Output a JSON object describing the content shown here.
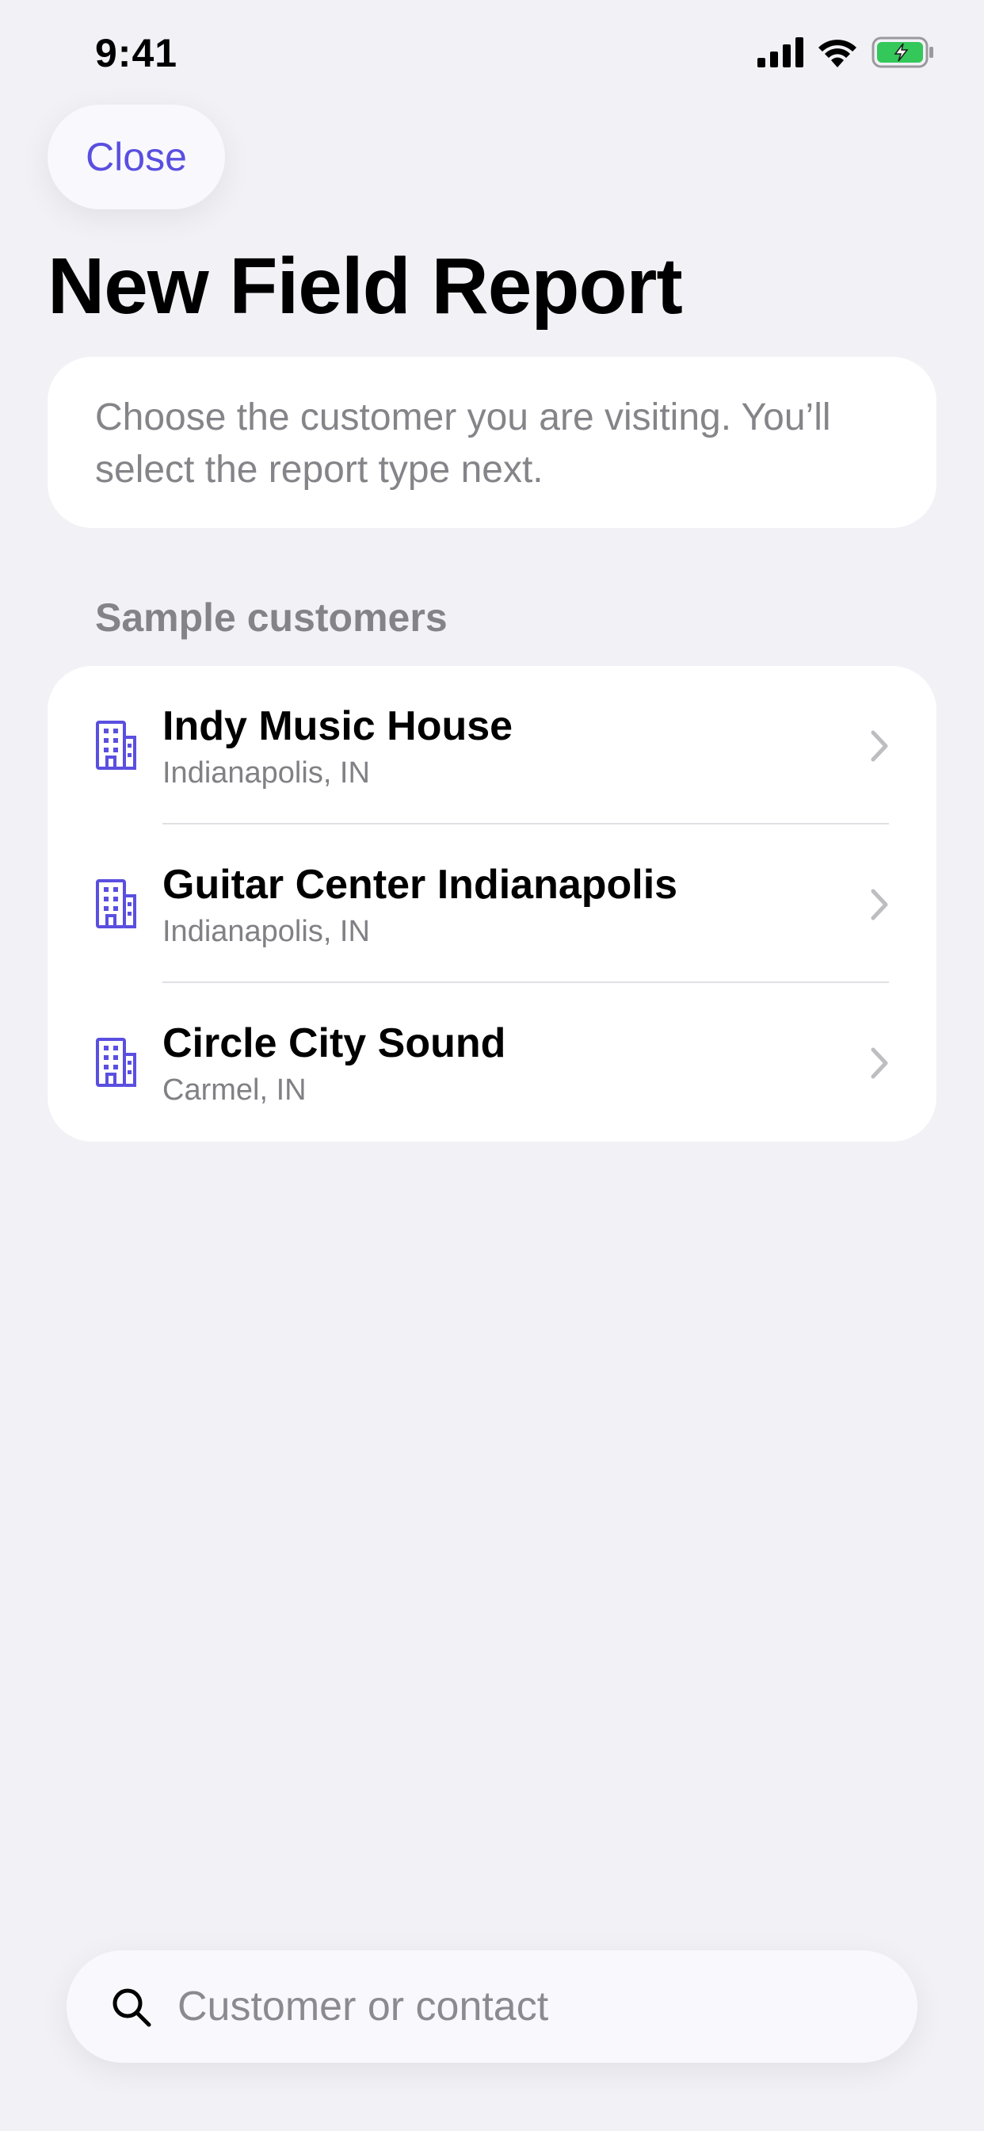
{
  "status_bar": {
    "time": "9:41",
    "icons": [
      "cellular-signal-icon",
      "wifi-icon",
      "battery-charging-icon"
    ]
  },
  "header": {
    "close_label": "Close",
    "title": "New Field Report"
  },
  "info": {
    "text": "Choose the customer you are visiting. You’ll select the report type next."
  },
  "section": {
    "title": "Sample customers"
  },
  "customers": [
    {
      "name": "Indy Music House",
      "location": "Indianapolis, IN",
      "icon": "building-icon"
    },
    {
      "name": "Guitar Center Indianapolis",
      "location": "Indianapolis, IN",
      "icon": "building-icon"
    },
    {
      "name": "Circle City Sound",
      "location": "Carmel, IN",
      "icon": "building-icon"
    }
  ],
  "search": {
    "placeholder": "Customer or contact",
    "value": ""
  },
  "colors": {
    "accent": "#5a4fe0",
    "background": "#f1f1f6",
    "battery": "#34c759"
  }
}
